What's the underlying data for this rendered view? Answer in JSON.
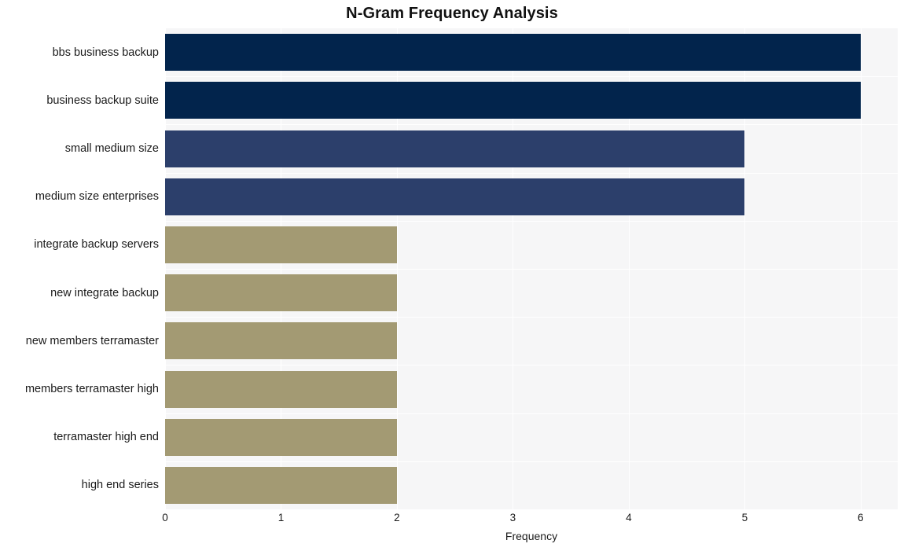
{
  "chart_data": {
    "type": "bar",
    "orientation": "horizontal",
    "title": "N-Gram Frequency Analysis",
    "xlabel": "Frequency",
    "ylabel": "",
    "categories": [
      "bbs business backup",
      "business backup suite",
      "small medium size",
      "medium size enterprises",
      "integrate backup servers",
      "new integrate backup",
      "new members terramaster",
      "members terramaster high",
      "terramaster high end",
      "high end series"
    ],
    "values": [
      6,
      6,
      5,
      5,
      2,
      2,
      2,
      2,
      2,
      2
    ],
    "bar_colors": [
      "#02244c",
      "#02244c",
      "#2c3f6b",
      "#2c3f6b",
      "#a39a73",
      "#a39a73",
      "#a39a73",
      "#a39a73",
      "#a39a73",
      "#a39a73"
    ],
    "xticks": [
      0,
      1,
      2,
      3,
      4,
      5,
      6
    ],
    "xtick_labels": [
      "0",
      "1",
      "2",
      "3",
      "4",
      "5",
      "6"
    ],
    "xlim": [
      0,
      6.32
    ],
    "grid": true,
    "grid_color": "#ffffff",
    "plot_background": "#f6f6f7",
    "figure_background": "#ffffff",
    "legend": null,
    "legend_position": "none"
  },
  "colors": {
    "navy_dark": "#02244c",
    "navy_mid": "#2c3f6b",
    "khaki": "#a39a73",
    "plot_bg": "#f6f6f7",
    "grid": "#ffffff",
    "text": "#1a1a1a"
  }
}
